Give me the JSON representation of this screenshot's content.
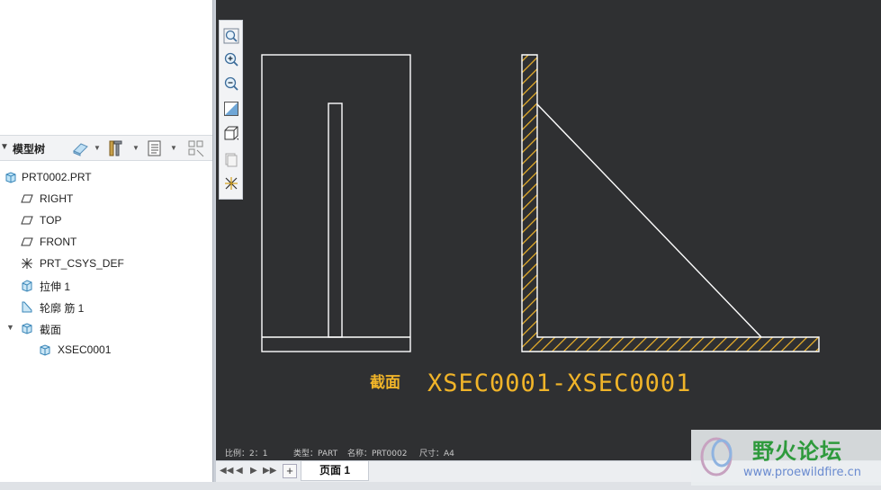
{
  "model_tree": {
    "title": "模型树",
    "items": [
      {
        "label": "PRT0002.PRT",
        "icon": "part-icon"
      },
      {
        "label": "RIGHT",
        "icon": "datum-plane-icon"
      },
      {
        "label": "TOP",
        "icon": "datum-plane-icon"
      },
      {
        "label": "FRONT",
        "icon": "datum-plane-icon"
      },
      {
        "label": "PRT_CSYS_DEF",
        "icon": "csys-icon"
      },
      {
        "label": "拉伸 1",
        "icon": "extrude-icon"
      },
      {
        "label": "轮廓 筋 1",
        "icon": "rib-icon"
      },
      {
        "label": "截面",
        "icon": "section-folder-icon"
      },
      {
        "label": "XSEC0001",
        "icon": "section-icon"
      }
    ]
  },
  "drawing": {
    "section_word": "截面",
    "section_name": "XSEC0001-XSEC0001",
    "title_block": {
      "scale": "比例：2：1",
      "type": "类型：PART",
      "name": "名称：PRT0002",
      "size": "尺寸：A4"
    }
  },
  "sheets": {
    "add_label": "+",
    "current": "页面 1"
  },
  "watermark": {
    "title": "野火论坛",
    "url": "www.proewildfire.cn"
  },
  "colors": {
    "canvas_bg": "#2f3032",
    "line": "#ffffff",
    "hatch": "#f0b429",
    "label": "#f0b429"
  }
}
